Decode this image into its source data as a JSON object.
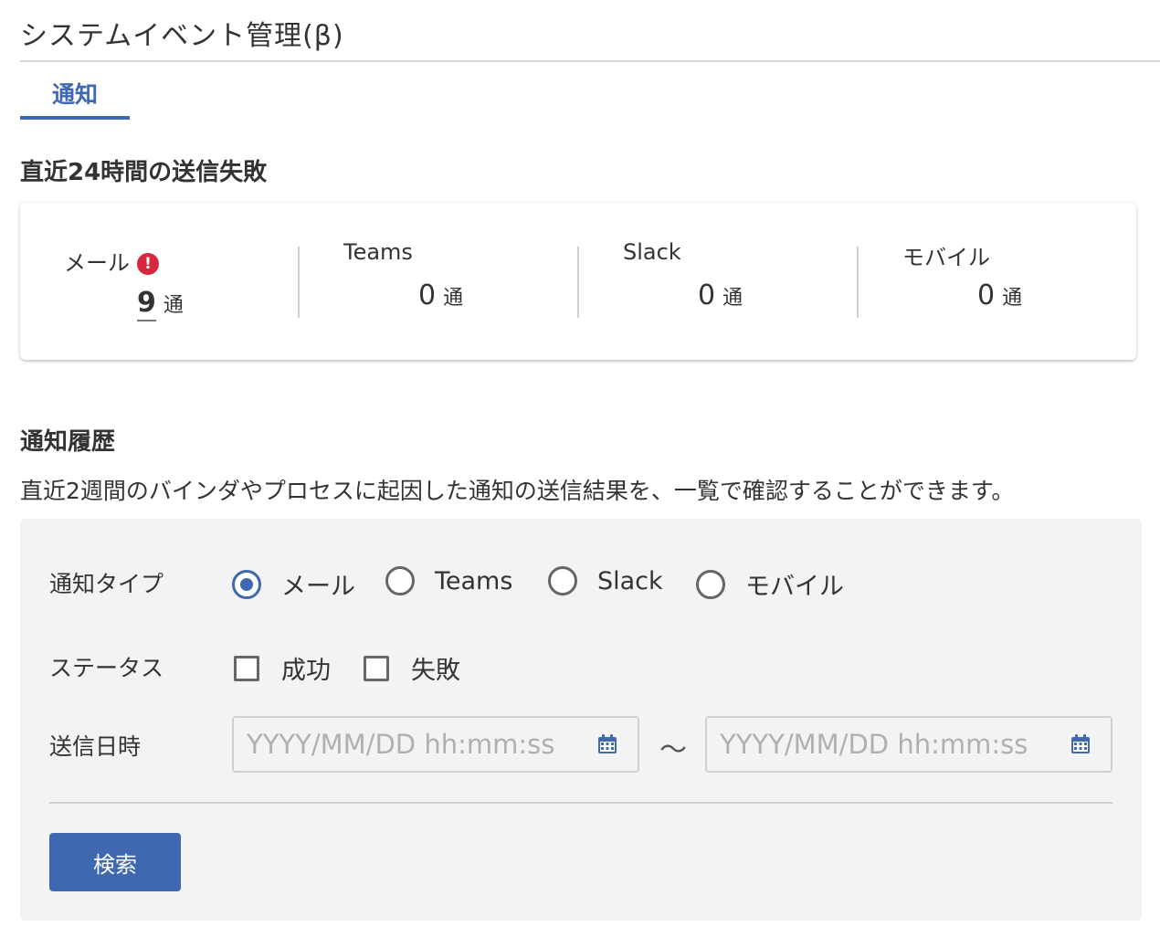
{
  "page": {
    "title": "システムイベント管理(β)"
  },
  "tabs": [
    {
      "label": "通知",
      "active": true
    }
  ],
  "summary": {
    "heading": "直近24時間の送信失敗",
    "unit": "通",
    "channels": [
      {
        "label": "メール",
        "count": "9",
        "alert": true
      },
      {
        "label": "Teams",
        "count": "0",
        "alert": false
      },
      {
        "label": "Slack",
        "count": "0",
        "alert": false
      },
      {
        "label": "モバイル",
        "count": "0",
        "alert": false
      }
    ],
    "alert_glyph": "!",
    "alert_color": "#d7263d"
  },
  "history": {
    "heading": "通知履歴",
    "description": "直近2週間のバインダやプロセスに起因した通知の送信結果を、一覧で確認することができます。"
  },
  "filters": {
    "type_label": "通知タイプ",
    "type_options": [
      {
        "label": "メール",
        "checked": true
      },
      {
        "label": "Teams",
        "checked": false
      },
      {
        "label": "Slack",
        "checked": false
      },
      {
        "label": "モバイル",
        "checked": false
      }
    ],
    "status_label": "ステータス",
    "status_options": [
      {
        "label": "成功",
        "checked": false
      },
      {
        "label": "失敗",
        "checked": false
      }
    ],
    "date_label": "送信日時",
    "date_from_placeholder": "YYYY/MM/DD hh:mm:ss",
    "date_to_placeholder": "YYYY/MM/DD hh:mm:ss",
    "range_separator": "〜",
    "search_label": "検索"
  },
  "colors": {
    "accent": "#3f68b0",
    "panel_bg": "#f3f3f3"
  }
}
